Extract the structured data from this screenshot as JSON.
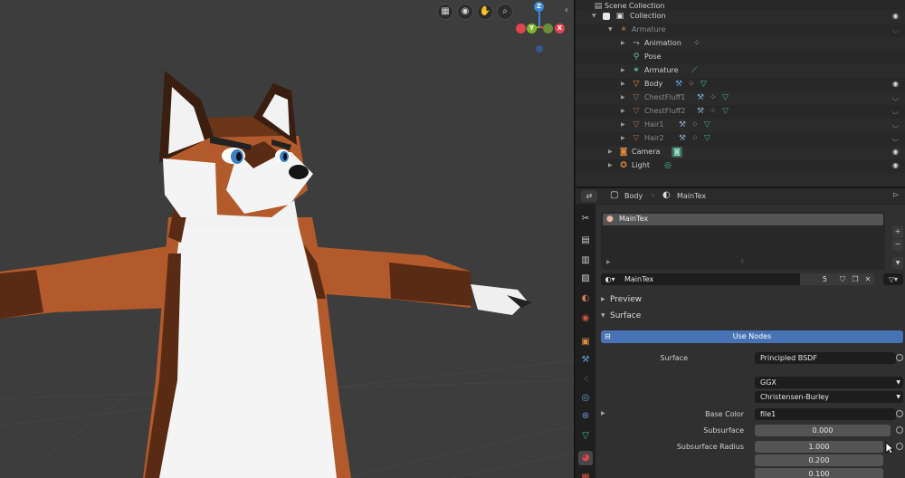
{
  "viewport": {
    "nav_icons": [
      "grid-icon",
      "camera-icon",
      "hand-icon",
      "zoom-icon"
    ],
    "gizmo": {
      "x_label": "X",
      "y_label": "Y",
      "z_label": "Z",
      "x_color": "#e0454f",
      "y_color": "#7fb62f",
      "z_color": "#3d86d6"
    }
  },
  "outliner": {
    "scene_collection": "Scene Collection",
    "collection": "Collection",
    "rows": [
      {
        "label": "Armature",
        "dim": true
      },
      {
        "label": "Animation"
      },
      {
        "label": "Pose"
      },
      {
        "label": "Armature"
      },
      {
        "label": "Body"
      },
      {
        "label": "ChestFluff1",
        "dim": true
      },
      {
        "label": "ChestFluff2",
        "dim": true
      },
      {
        "label": "Hair1",
        "dim": true
      },
      {
        "label": "Hair2",
        "dim": true
      },
      {
        "label": "Camera"
      },
      {
        "label": "Light"
      }
    ]
  },
  "properties": {
    "header": {
      "object_name": "Body",
      "material_name": "MainTex"
    },
    "material_slot": "MainTex",
    "material_field": {
      "name": "MainTex",
      "users": "5"
    },
    "panels": {
      "preview": "Preview",
      "surface": "Surface"
    },
    "use_nodes_label": "Use Nodes",
    "surface": {
      "surface_label": "Surface",
      "surface_value": "Principled BSDF",
      "distribution": "GGX",
      "subsurface_method": "Christensen-Burley",
      "base_color_label": "Base Color",
      "base_color_value": "file1",
      "subsurface_label": "Subsurface",
      "subsurface_value": "0.000",
      "subsurface_radius_label": "Subsurface Radius",
      "subsurface_radius": [
        "1.000",
        "0.200",
        "0.100"
      ]
    },
    "colors": {
      "accent_blue": "#4772b3",
      "active_row": "#334d80"
    }
  }
}
